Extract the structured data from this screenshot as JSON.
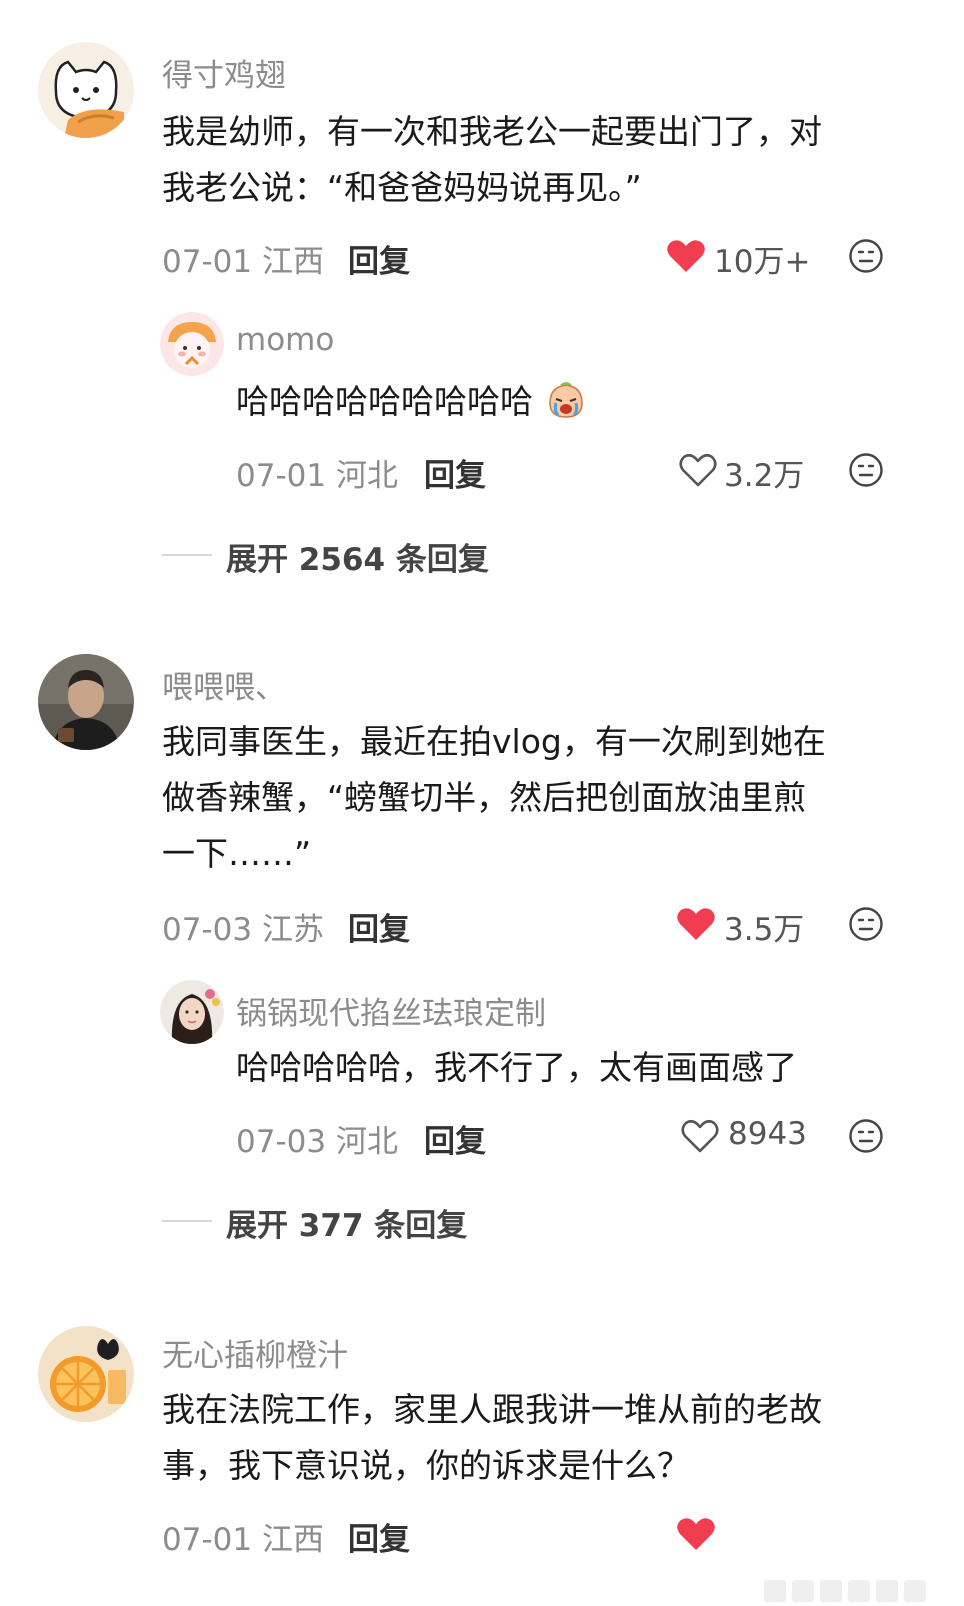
{
  "comments": [
    {
      "username": "得寸鸡翅",
      "text_lines": [
        "我是幼师，有一次和我老公一起要出门了，对",
        "我老公说：“和爸爸妈妈说再见。”"
      ],
      "date": "07-01",
      "location": "江西",
      "reply_label": "回复",
      "likes": "10万+",
      "liked": true,
      "reply": {
        "username": "momo",
        "text": "哈哈哈哈哈哈哈哈哈",
        "date": "07-01",
        "location": "河北",
        "reply_label": "回复",
        "likes": "3.2万",
        "liked": false
      },
      "expand_text": "展开 2564 条回复"
    },
    {
      "username": "喂喂喂、",
      "text_lines": [
        "我同事医生，最近在拍vlog，有一次刷到她在",
        "做香辣蟹，“螃蟹切半，然后把创面放油里煎",
        "一下……”"
      ],
      "date": "07-03",
      "location": "江苏",
      "reply_label": "回复",
      "likes": "3.5万",
      "liked": true,
      "reply": {
        "username": "锅锅现代掐丝珐琅定制",
        "text": "哈哈哈哈哈，我不行了，太有画面感了",
        "date": "07-03",
        "location": "河北",
        "reply_label": "回复",
        "likes": "8943",
        "liked": false
      },
      "expand_text": "展开 377 条回复"
    },
    {
      "username": "无心插柳橙汁",
      "text_lines": [
        "我在法院工作，家里人跟我讲一堆从前的老故",
        "事，我下意识说，你的诉求是什么？"
      ],
      "date": "07-01",
      "location": "江西",
      "reply_label": "回复",
      "liked": true
    }
  ],
  "colors": {
    "heart_red": "#f03d4f",
    "meta_gray": "#8c8c8c"
  },
  "icons": {
    "like": "heart-icon",
    "emoji": "emoji-face-icon"
  }
}
